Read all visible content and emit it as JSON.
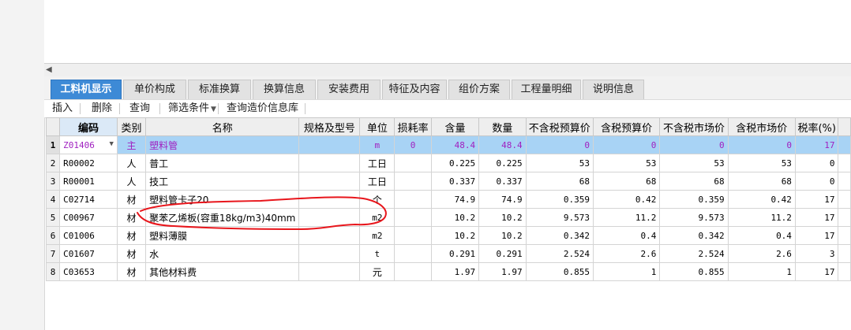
{
  "tabs": [
    {
      "label": "工料机显示",
      "active": true
    },
    {
      "label": "单价构成"
    },
    {
      "label": "标准换算"
    },
    {
      "label": "换算信息"
    },
    {
      "label": "安装费用"
    },
    {
      "label": "特征及内容"
    },
    {
      "label": "组价方案"
    },
    {
      "label": "工程量明细"
    },
    {
      "label": "说明信息"
    }
  ],
  "toolbar": {
    "insert": "插入",
    "delete": "删除",
    "query": "查询",
    "filter": "筛选条件",
    "query_price_lib": "查询造价信息库"
  },
  "columns": [
    "编码",
    "类别",
    "名称",
    "规格及型号",
    "单位",
    "损耗率",
    "含量",
    "数量",
    "不含税预算价",
    "含税预算价",
    "不含税市场价",
    "含税市场价",
    "税率(%)"
  ],
  "rows": [
    {
      "n": "1",
      "code": "Z01406",
      "cat": "主",
      "name": "塑料管",
      "spec": "",
      "unit": "m",
      "loss": "0",
      "content": "48.4",
      "qty": "48.4",
      "p1": "0",
      "p2": "0",
      "p3": "0",
      "p4": "0",
      "tax": "17"
    },
    {
      "n": "2",
      "code": "R00002",
      "cat": "人",
      "name": "普工",
      "spec": "",
      "unit": "工日",
      "loss": "",
      "content": "0.225",
      "qty": "0.225",
      "p1": "53",
      "p2": "53",
      "p3": "53",
      "p4": "53",
      "tax": "0"
    },
    {
      "n": "3",
      "code": "R00001",
      "cat": "人",
      "name": "技工",
      "spec": "",
      "unit": "工日",
      "loss": "",
      "content": "0.337",
      "qty": "0.337",
      "p1": "68",
      "p2": "68",
      "p3": "68",
      "p4": "68",
      "tax": "0"
    },
    {
      "n": "4",
      "code": "C02714",
      "cat": "材",
      "name": "塑料管卡子20",
      "spec": "",
      "unit": "个",
      "loss": "",
      "content": "74.9",
      "qty": "74.9",
      "p1": "0.359",
      "p2": "0.42",
      "p3": "0.359",
      "p4": "0.42",
      "tax": "17"
    },
    {
      "n": "5",
      "code": "C00967",
      "cat": "材",
      "name": "聚苯乙烯板(容重18kg/m3)40mm",
      "spec": "",
      "unit": "m2",
      "loss": "",
      "content": "10.2",
      "qty": "10.2",
      "p1": "9.573",
      "p2": "11.2",
      "p3": "9.573",
      "p4": "11.2",
      "tax": "17"
    },
    {
      "n": "6",
      "code": "C01006",
      "cat": "材",
      "name": "塑料薄膜",
      "spec": "",
      "unit": "m2",
      "loss": "",
      "content": "10.2",
      "qty": "10.2",
      "p1": "0.342",
      "p2": "0.4",
      "p3": "0.342",
      "p4": "0.4",
      "tax": "17"
    },
    {
      "n": "7",
      "code": "C01607",
      "cat": "材",
      "name": "水",
      "spec": "",
      "unit": "t",
      "loss": "",
      "content": "0.291",
      "qty": "0.291",
      "p1": "2.524",
      "p2": "2.6",
      "p3": "2.524",
      "p4": "2.6",
      "tax": "3"
    },
    {
      "n": "8",
      "code": "C03653",
      "cat": "材",
      "name": "其他材料费",
      "spec": "",
      "unit": "元",
      "loss": "",
      "content": "1.97",
      "qty": "1.97",
      "p1": "0.855",
      "p2": "1",
      "p3": "0.855",
      "p4": "1",
      "tax": "17"
    }
  ],
  "annotation_color": "#e8161c",
  "selected_row_color": "#a8d3f5",
  "active_tab_color": "#3d8ad6"
}
